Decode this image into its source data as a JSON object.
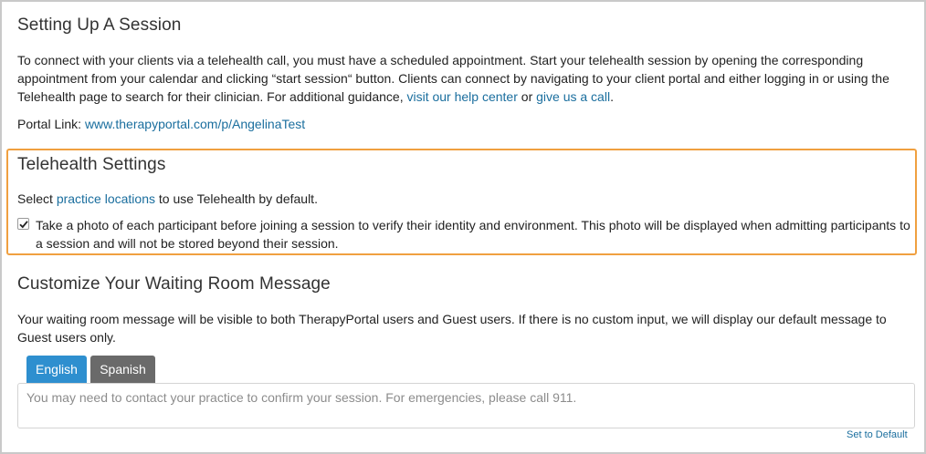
{
  "setup": {
    "title": "Setting Up A Session",
    "intro": "To connect with your clients via a telehealth call, you must have a scheduled appointment. Start your telehealth session by opening the corresponding appointment from your calendar and clicking “start session“ button. Clients can connect by navigating to your client portal and either logging in or using the Telehealth page to search for their clinician. For additional guidance, ",
    "help_link": "visit our help center",
    "or_text": " or ",
    "call_link": "give us a call",
    "end_text": ".",
    "portal_label": "Portal Link: ",
    "portal_url": "www.therapyportal.com/p/AngelinaTest"
  },
  "telehealth": {
    "title": "Telehealth Settings",
    "select_prefix": "Select ",
    "locations_link": "practice locations",
    "select_suffix": " to use Telehealth by default.",
    "photo_checkbox_checked": true,
    "photo_checkbox_label": "Take a photo of each participant before joining a session to verify their identity and environment. This photo will be displayed when admitting participants to a session and will not be stored beyond their session.",
    "highlight_color": "#f0a040"
  },
  "waiting_room": {
    "title": "Customize Your Waiting Room Message",
    "description": "Your waiting room message will be visible to both TherapyPortal users and Guest users. If there is no custom input, we will display our default message to Guest users only.",
    "tabs": [
      {
        "label": "English",
        "active": true,
        "color": "#2e8fcf"
      },
      {
        "label": "Spanish",
        "active": false,
        "color": "#6a6a6a"
      }
    ],
    "message_placeholder": "You may need to contact your practice to confirm your session. For emergencies, please call 911.",
    "set_default_label": "Set to Default"
  },
  "colors": {
    "link": "#1a6e9e",
    "frame_border": "#c9c9c9"
  }
}
